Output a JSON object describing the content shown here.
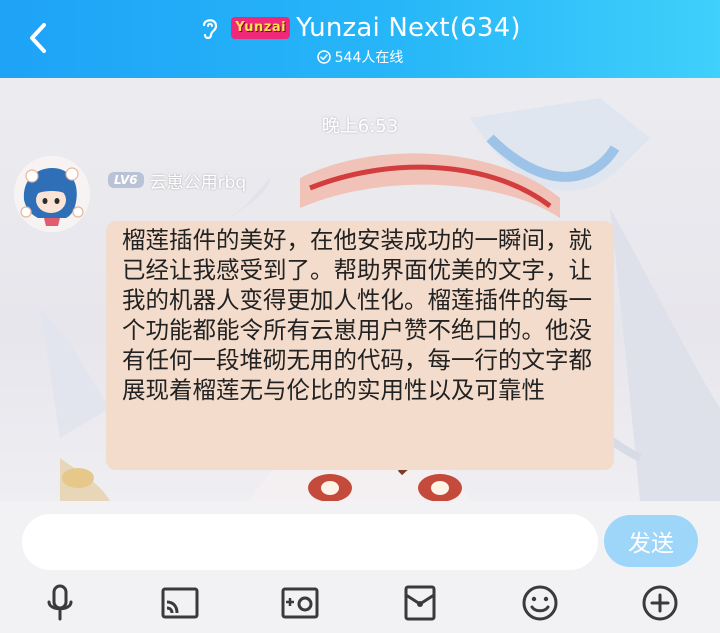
{
  "header": {
    "group_badge": "Yunzai",
    "title": "Yunzai Next(634)",
    "online": "544人在线"
  },
  "chat": {
    "timestamp": "晚上6:53",
    "message": {
      "level": "LV6",
      "sender": "云崽公用rbq",
      "text": "榴莲插件的美好，在他安装成功的一瞬间，就已经让我感受到了。帮助界面优美的文字，让我的机器人变得更加人性化。榴莲插件的每一个功能都能令所有云崽用户赞不绝口的。他没有任何一段堆砌无用的代码，每一行的文字都展现着榴莲无与伦比的实用性以及可靠性"
    }
  },
  "input": {
    "value": "",
    "send_label": "发送"
  },
  "toolbar": {
    "icons": [
      "microphone-icon",
      "screen-cast-icon",
      "photo-icon",
      "red-packet-icon",
      "emoji-icon",
      "plus-icon"
    ]
  },
  "colors": {
    "header_start": "#1ea3f7",
    "header_end": "#3fd0fb",
    "bubble": "#f3dccb",
    "send_button": "#9ed6f9",
    "icon": "#3a3a3a"
  }
}
